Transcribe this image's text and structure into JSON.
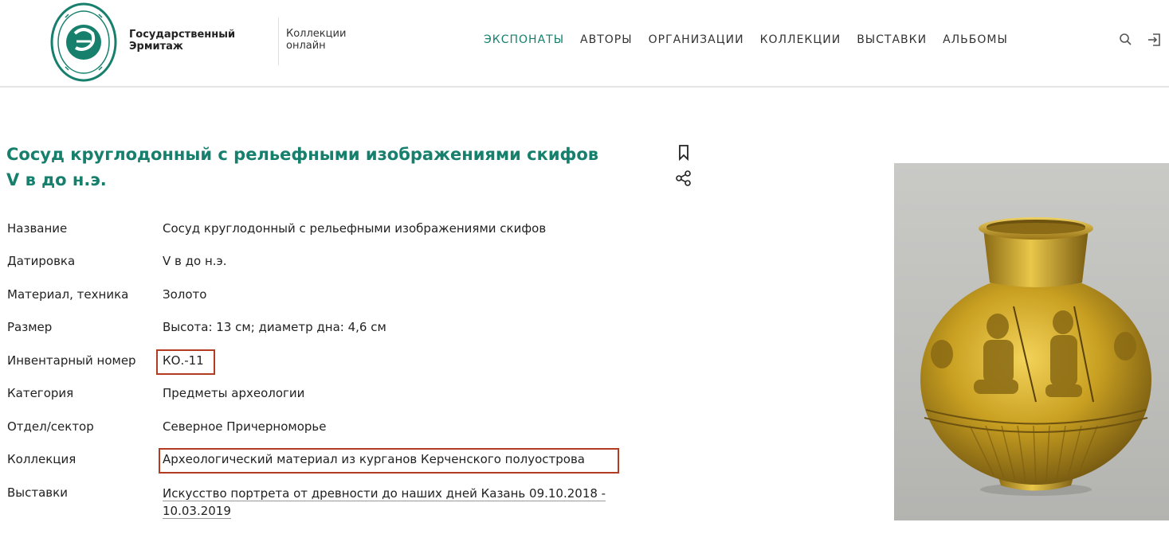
{
  "header": {
    "brand": {
      "line1": "Государственный",
      "line2": "Эрмитаж"
    },
    "collections": {
      "line1": "Коллекции",
      "line2": "онлайн"
    },
    "nav": [
      {
        "label": "ЭКСПОНАТЫ",
        "active": true
      },
      {
        "label": "АВТОРЫ",
        "active": false
      },
      {
        "label": "ОРГАНИЗАЦИИ",
        "active": false
      },
      {
        "label": "КОЛЛЕКЦИИ",
        "active": false
      },
      {
        "label": "ВЫСТАВКИ",
        "active": false
      },
      {
        "label": "АЛЬБОМЫ",
        "active": false
      }
    ],
    "icons": [
      "search-icon",
      "login-icon"
    ]
  },
  "item": {
    "title": "Сосуд круглодонный с рельефными изображениями скифов V в до н.э.",
    "actions": [
      "bookmark-icon",
      "share-icon"
    ],
    "details": [
      {
        "label": "Название",
        "value": "Сосуд круглодонный с рельефными изображениями скифов"
      },
      {
        "label": "Датировка",
        "value": "V в до н.э."
      },
      {
        "label": "Материал, техника",
        "value": "Золото"
      },
      {
        "label": "Размер",
        "value": "Высота: 13 см; диаметр дна: 4,6 см"
      },
      {
        "label": "Инвентарный номер",
        "value": "КО.-11"
      },
      {
        "label": "Категория",
        "value": "Предметы археологии"
      },
      {
        "label": "Отдел/сектор",
        "value": "Северное Причерноморье"
      },
      {
        "label": "Коллекция",
        "value": "Археологический материал из курганов Керченского полуострова"
      }
    ],
    "exhibitions": {
      "label": "Выставки",
      "line1": "Искусство портрета от древности до наших дней Казань 09.10.2018 -",
      "line2": "10.03.2019"
    }
  },
  "colors": {
    "accent": "#16806d",
    "highlight": "#b33b22",
    "gold": "#c9a021"
  }
}
